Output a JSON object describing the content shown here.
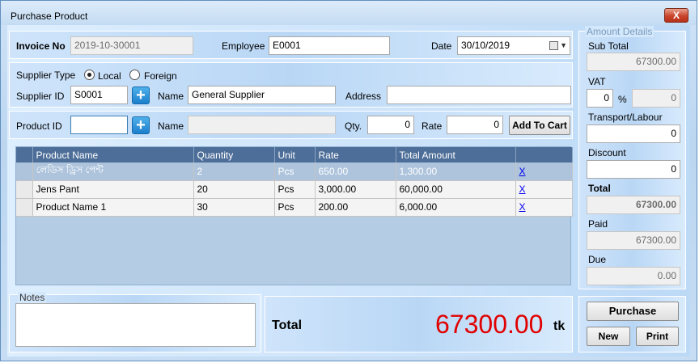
{
  "window": {
    "title": "Purchase Product",
    "close_label": "X"
  },
  "invoice": {
    "invoice_no_label": "Invoice No",
    "invoice_no_value": "2019-10-30001",
    "employee_label": "Employee",
    "employee_value": "E0001",
    "date_label": "Date",
    "date_value": "30/10/2019"
  },
  "supplier": {
    "type_label": "Supplier Type",
    "local_label": "Local",
    "foreign_label": "Foreign",
    "selected_type": "Local",
    "id_label": "Supplier ID",
    "id_value": "S0001",
    "name_label": "Name",
    "name_value": "General Supplier",
    "address_label": "Address",
    "address_value": ""
  },
  "product": {
    "id_label": "Product ID",
    "id_value": "",
    "name_label": "Name",
    "name_value": "",
    "qty_label": "Qty.",
    "qty_value": "0",
    "rate_label": "Rate",
    "rate_value": "0",
    "add_to_cart_label": "Add To Cart"
  },
  "cart": {
    "columns": [
      "Product Name",
      "Quantity",
      "Unit",
      "Rate",
      "Total Amount",
      ""
    ],
    "rows": [
      {
        "name": "লেডিস ড্রিস পেন্ট",
        "quantity": "2",
        "unit": "Pcs",
        "rate": "650.00",
        "total": "1,300.00",
        "remove": "X"
      },
      {
        "name": "Jens Pant",
        "quantity": "20",
        "unit": "Pcs",
        "rate": "3,000.00",
        "total": "60,000.00",
        "remove": "X"
      },
      {
        "name": "Product Name 1",
        "quantity": "30",
        "unit": "Pcs",
        "rate": "200.00",
        "total": "6,000.00",
        "remove": "X"
      }
    ]
  },
  "notes": {
    "label": "Notes",
    "value": ""
  },
  "total_box": {
    "label": "Total",
    "amount": "67300.00",
    "currency": "tk"
  },
  "amount_details": {
    "title": "Amount Details",
    "sub_total_label": "Sub Total",
    "sub_total_value": "67300.00",
    "vat_label": "VAT",
    "vat_percent": "0",
    "percent_sign": "%",
    "vat_amount": "0",
    "transport_label": "Transport/Labour",
    "transport_value": "0",
    "discount_label": "Discount",
    "discount_value": "0",
    "total_label": "Total",
    "total_value": "67300.00",
    "paid_label": "Paid",
    "paid_value": "67300.00",
    "due_label": "Due",
    "due_value": "0.00"
  },
  "actions": {
    "purchase_label": "Purchase",
    "new_label": "New",
    "print_label": "Print"
  },
  "colors": {
    "total_amount": "#e00000",
    "grid_header": "#4d6e98",
    "link": "#0000ee"
  }
}
